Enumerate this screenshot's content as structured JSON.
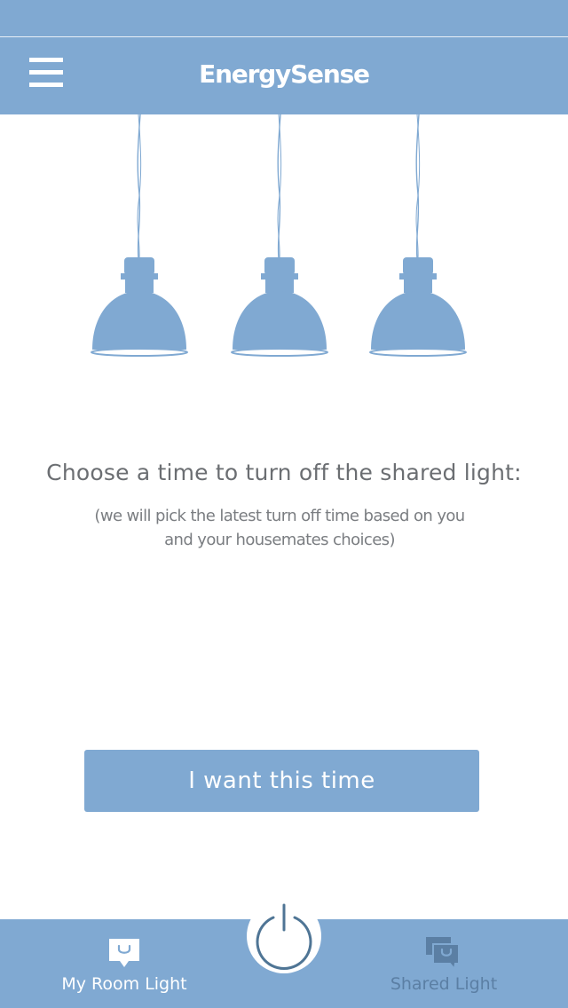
{
  "app": {
    "title": "EnergySense"
  },
  "header": {
    "menu_icon": "hamburger-menu-icon"
  },
  "hero": {
    "illustration": "pendant-lamps",
    "lamp_count": 3
  },
  "prompt": {
    "title": "Choose a time to turn off the shared light:",
    "note_line1": "(we will pick the latest turn off time based on you",
    "note_line2": "and your housemates choices)"
  },
  "actions": {
    "confirm_label": "I want this time"
  },
  "tab_bar": {
    "tabs": [
      {
        "label": "My Room Light",
        "icon": "single-chat-bubble-icon",
        "active": true
      },
      {
        "label": "Shared Light",
        "icon": "double-chat-bubble-icon",
        "active": false
      }
    ],
    "center_icon": "power-icon"
  },
  "colors": {
    "accent": "#80a9d2",
    "accent_dark": "#5b7fa4",
    "text_primary": "#6b6e72",
    "text_secondary": "#7a7d81",
    "background": "#ffffff"
  }
}
